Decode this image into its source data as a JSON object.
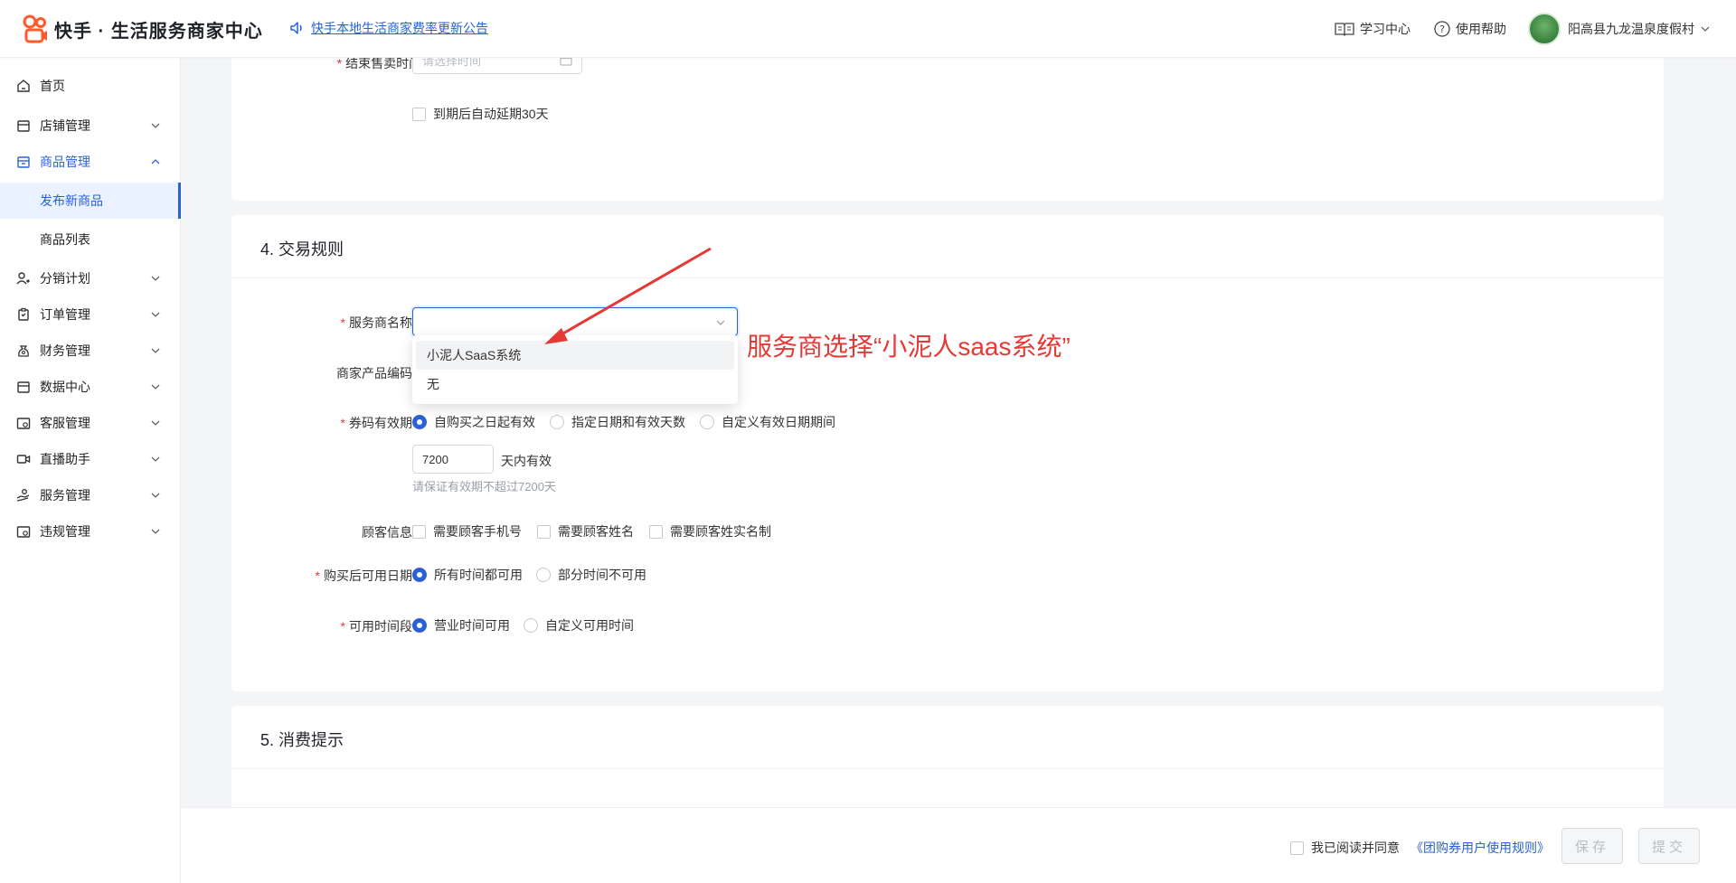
{
  "header": {
    "brand": "快手 · 生活服务商家中心",
    "notice": "快手本地生活商家费率更新公告",
    "learning_center": "学习中心",
    "help": "使用帮助",
    "merchant_name": "阳高县九龙温泉度假村"
  },
  "sidebar": {
    "items": [
      {
        "label": "首页",
        "icon": "home-icon"
      },
      {
        "label": "店铺管理",
        "icon": "store-icon"
      },
      {
        "label": "商品管理",
        "icon": "box-icon"
      },
      {
        "label": "分销计划",
        "icon": "user-share-icon"
      },
      {
        "label": "订单管理",
        "icon": "clipboard-icon"
      },
      {
        "label": "财务管理",
        "icon": "money-bag-icon"
      },
      {
        "label": "数据中心",
        "icon": "data-icon"
      },
      {
        "label": "客服管理",
        "icon": "service-icon"
      },
      {
        "label": "直播助手",
        "icon": "camera-icon"
      },
      {
        "label": "服务管理",
        "icon": "hand-icon"
      },
      {
        "label": "违规管理",
        "icon": "warning-icon"
      }
    ],
    "sub_items": [
      {
        "label": "发布新商品",
        "active": true
      },
      {
        "label": "商品列表",
        "active": false
      }
    ]
  },
  "section3": {
    "end_sale_label": "结束售卖时间",
    "end_sale_placeholder": "请选择时间",
    "auto_extend": "到期后自动延期30天"
  },
  "section4": {
    "title": "4. 交易规则",
    "provider_label": "服务商名称",
    "provider_options": [
      "小泥人SaaS系统",
      "无"
    ],
    "product_code_label": "商家产品编码",
    "validity_label": "券码有效期",
    "validity_options": [
      "自购买之日起有效",
      "指定日期和有效天数",
      "自定义有效日期期间"
    ],
    "validity_days": "7200",
    "validity_suffix": "天内有效",
    "validity_hint": "请保证有效期不超过7200天",
    "customer_info_label": "顾客信息",
    "customer_info_options": [
      "需要顾客手机号",
      "需要顾客姓名",
      "需要顾客姓实名制"
    ],
    "usable_date_label": "购买后可用日期",
    "usable_date_options": [
      "所有时间都可用",
      "部分时间不可用"
    ],
    "usable_time_label": "可用时间段",
    "usable_time_options": [
      "营业时间可用",
      "自定义可用时间"
    ]
  },
  "section5": {
    "title": "5. 消费提示"
  },
  "annotation": "服务商选择“小泥人saas系统”",
  "footer": {
    "agree_text": "我已阅读并同意",
    "agree_link": "《团购券用户使用规则》",
    "save": "保存",
    "submit": "提交"
  },
  "colors": {
    "accent": "#2a62d6",
    "required": "#e03a3a",
    "annotation": "#e53935"
  }
}
